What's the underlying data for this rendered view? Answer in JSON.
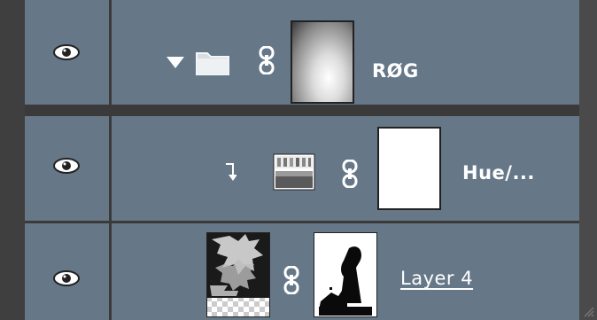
{
  "panel": {
    "layers": [
      {
        "name": "RØG",
        "type": "group",
        "expanded": true,
        "visible": true,
        "icons": {
          "eye": "eye-icon",
          "expand": "triangle-down-icon",
          "group": "folder-icon",
          "link": "chain-link-icon",
          "mask": "radial-gradient-mask-thumbnail"
        }
      },
      {
        "name": "Hue/...",
        "type": "adjustment",
        "clipped": true,
        "visible": true,
        "icons": {
          "eye": "eye-icon",
          "clip": "clipping-arrow-icon",
          "adjustment": "hue-saturation-adjustment-icon",
          "link": "chain-link-icon",
          "mask": "white-mask-thumbnail"
        }
      },
      {
        "name": "Layer 4",
        "type": "pixel",
        "visible": true,
        "icons": {
          "eye": "eye-icon",
          "layer": "smoke-texture-thumbnail",
          "link": "chain-link-icon",
          "mask": "silhouette-mask-thumbnail"
        }
      }
    ]
  },
  "colors": {
    "row_background": "#667788",
    "panel_background": "#3a3a3a",
    "label_text": "#ffffff"
  }
}
